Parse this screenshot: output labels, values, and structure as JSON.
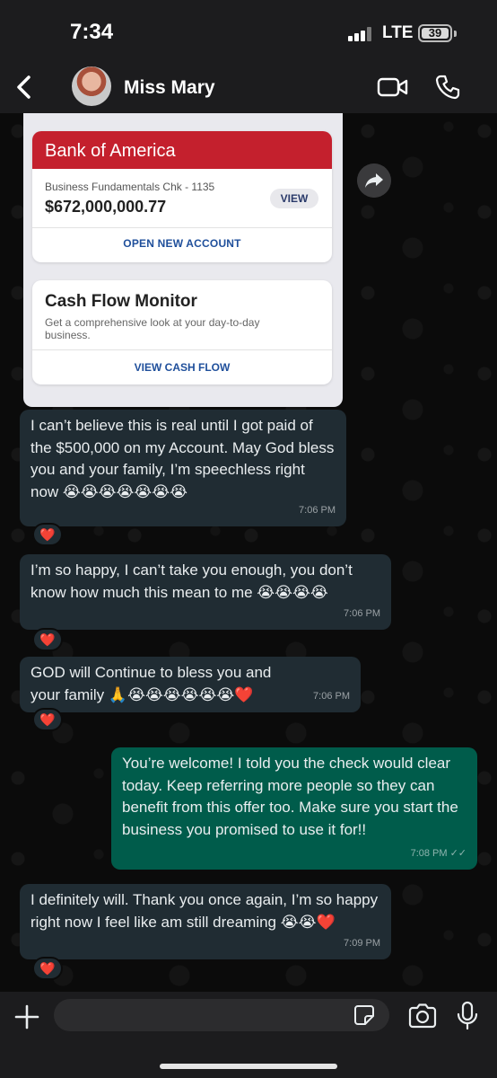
{
  "status_bar": {
    "time": "7:34",
    "network": "LTE",
    "battery": "39"
  },
  "header": {
    "contact_name": "Miss Mary"
  },
  "shared_image": {
    "bank_name": "Bank of America",
    "account_name": "Business Fundamentals Chk - 1135",
    "balance": "$672,000,000.77",
    "view_label": "VIEW",
    "open_account_label": "OPEN NEW ACCOUNT",
    "cashflow_title": "Cash Flow Monitor",
    "cashflow_description": "Get a comprehensive look at your day-to-day business.",
    "cashflow_link": "VIEW CASH FLOW"
  },
  "messages": [
    {
      "direction": "incoming",
      "text": "I can’t believe this is real until I got paid of the $500,000 on  my  Account. May God bless you and your family, I’m speechless right now 😭😭😭😭😭😭😭",
      "time": "7:06 PM",
      "reaction": "❤️"
    },
    {
      "direction": "incoming",
      "text": "I’m so happy, I can’t take you enough, you don’t know how much this mean to me 😭😭😭😭",
      "time": "7:06 PM",
      "reaction": "❤️"
    },
    {
      "direction": "incoming",
      "text": "GOD will Continue to bless you  and your family 🙏😭😭😭😭😭😭❤️",
      "time": "7:06 PM",
      "reaction": "❤️"
    },
    {
      "direction": "outgoing",
      "text": "You’re welcome! I told you the check would clear today. Keep referring more people so they can benefit from this offer too. Make sure you start the business you promised to use it for!!",
      "time": "7:08 PM",
      "ticks": "✓✓"
    },
    {
      "direction": "incoming",
      "text": "I definitely will. Thank you once again, I’m so happy right now  I feel like am still dreaming 😭😭❤️",
      "time": "7:09 PM",
      "reaction": "❤️"
    }
  ],
  "input": {
    "placeholder": ""
  },
  "colors": {
    "incoming_bubble": "#202c33",
    "outgoing_bubble": "#005c4b",
    "bank_red": "#c4202d"
  }
}
